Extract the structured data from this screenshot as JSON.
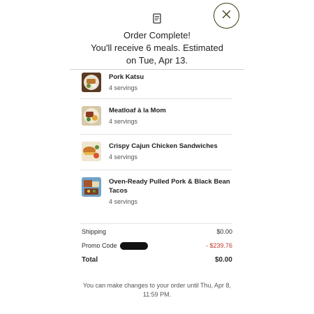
{
  "header": {
    "icon": "receipt-icon",
    "title": "Order Complete!",
    "line2": "You'll receive 6 meals. Estimated",
    "line3": "on Tue, Apr 13."
  },
  "close": {
    "icon": "close-icon"
  },
  "meals": [
    {
      "name": "Pork Katsu",
      "servings": "4 servings"
    },
    {
      "name": "Meatloaf à la Mom",
      "servings": "4 servings"
    },
    {
      "name": "Crispy Cajun Chicken Sandwiches",
      "servings": "4 servings"
    },
    {
      "name": "Oven-Ready Pulled Pork & Black Bean Tacos",
      "servings": "4 servings"
    }
  ],
  "summary": {
    "shipping_label": "Shipping",
    "shipping_value": "$0.00",
    "promo_label": "Promo Code",
    "promo_value": "- $239.76",
    "total_label": "Total",
    "total_value": "$0.00"
  },
  "footer": {
    "line1": "You can make changes to your order until Thu, Apr 8,",
    "line2": "11:59 PM."
  },
  "colors": {
    "discount": "#c0392b",
    "close_border": "#3f3a12"
  }
}
